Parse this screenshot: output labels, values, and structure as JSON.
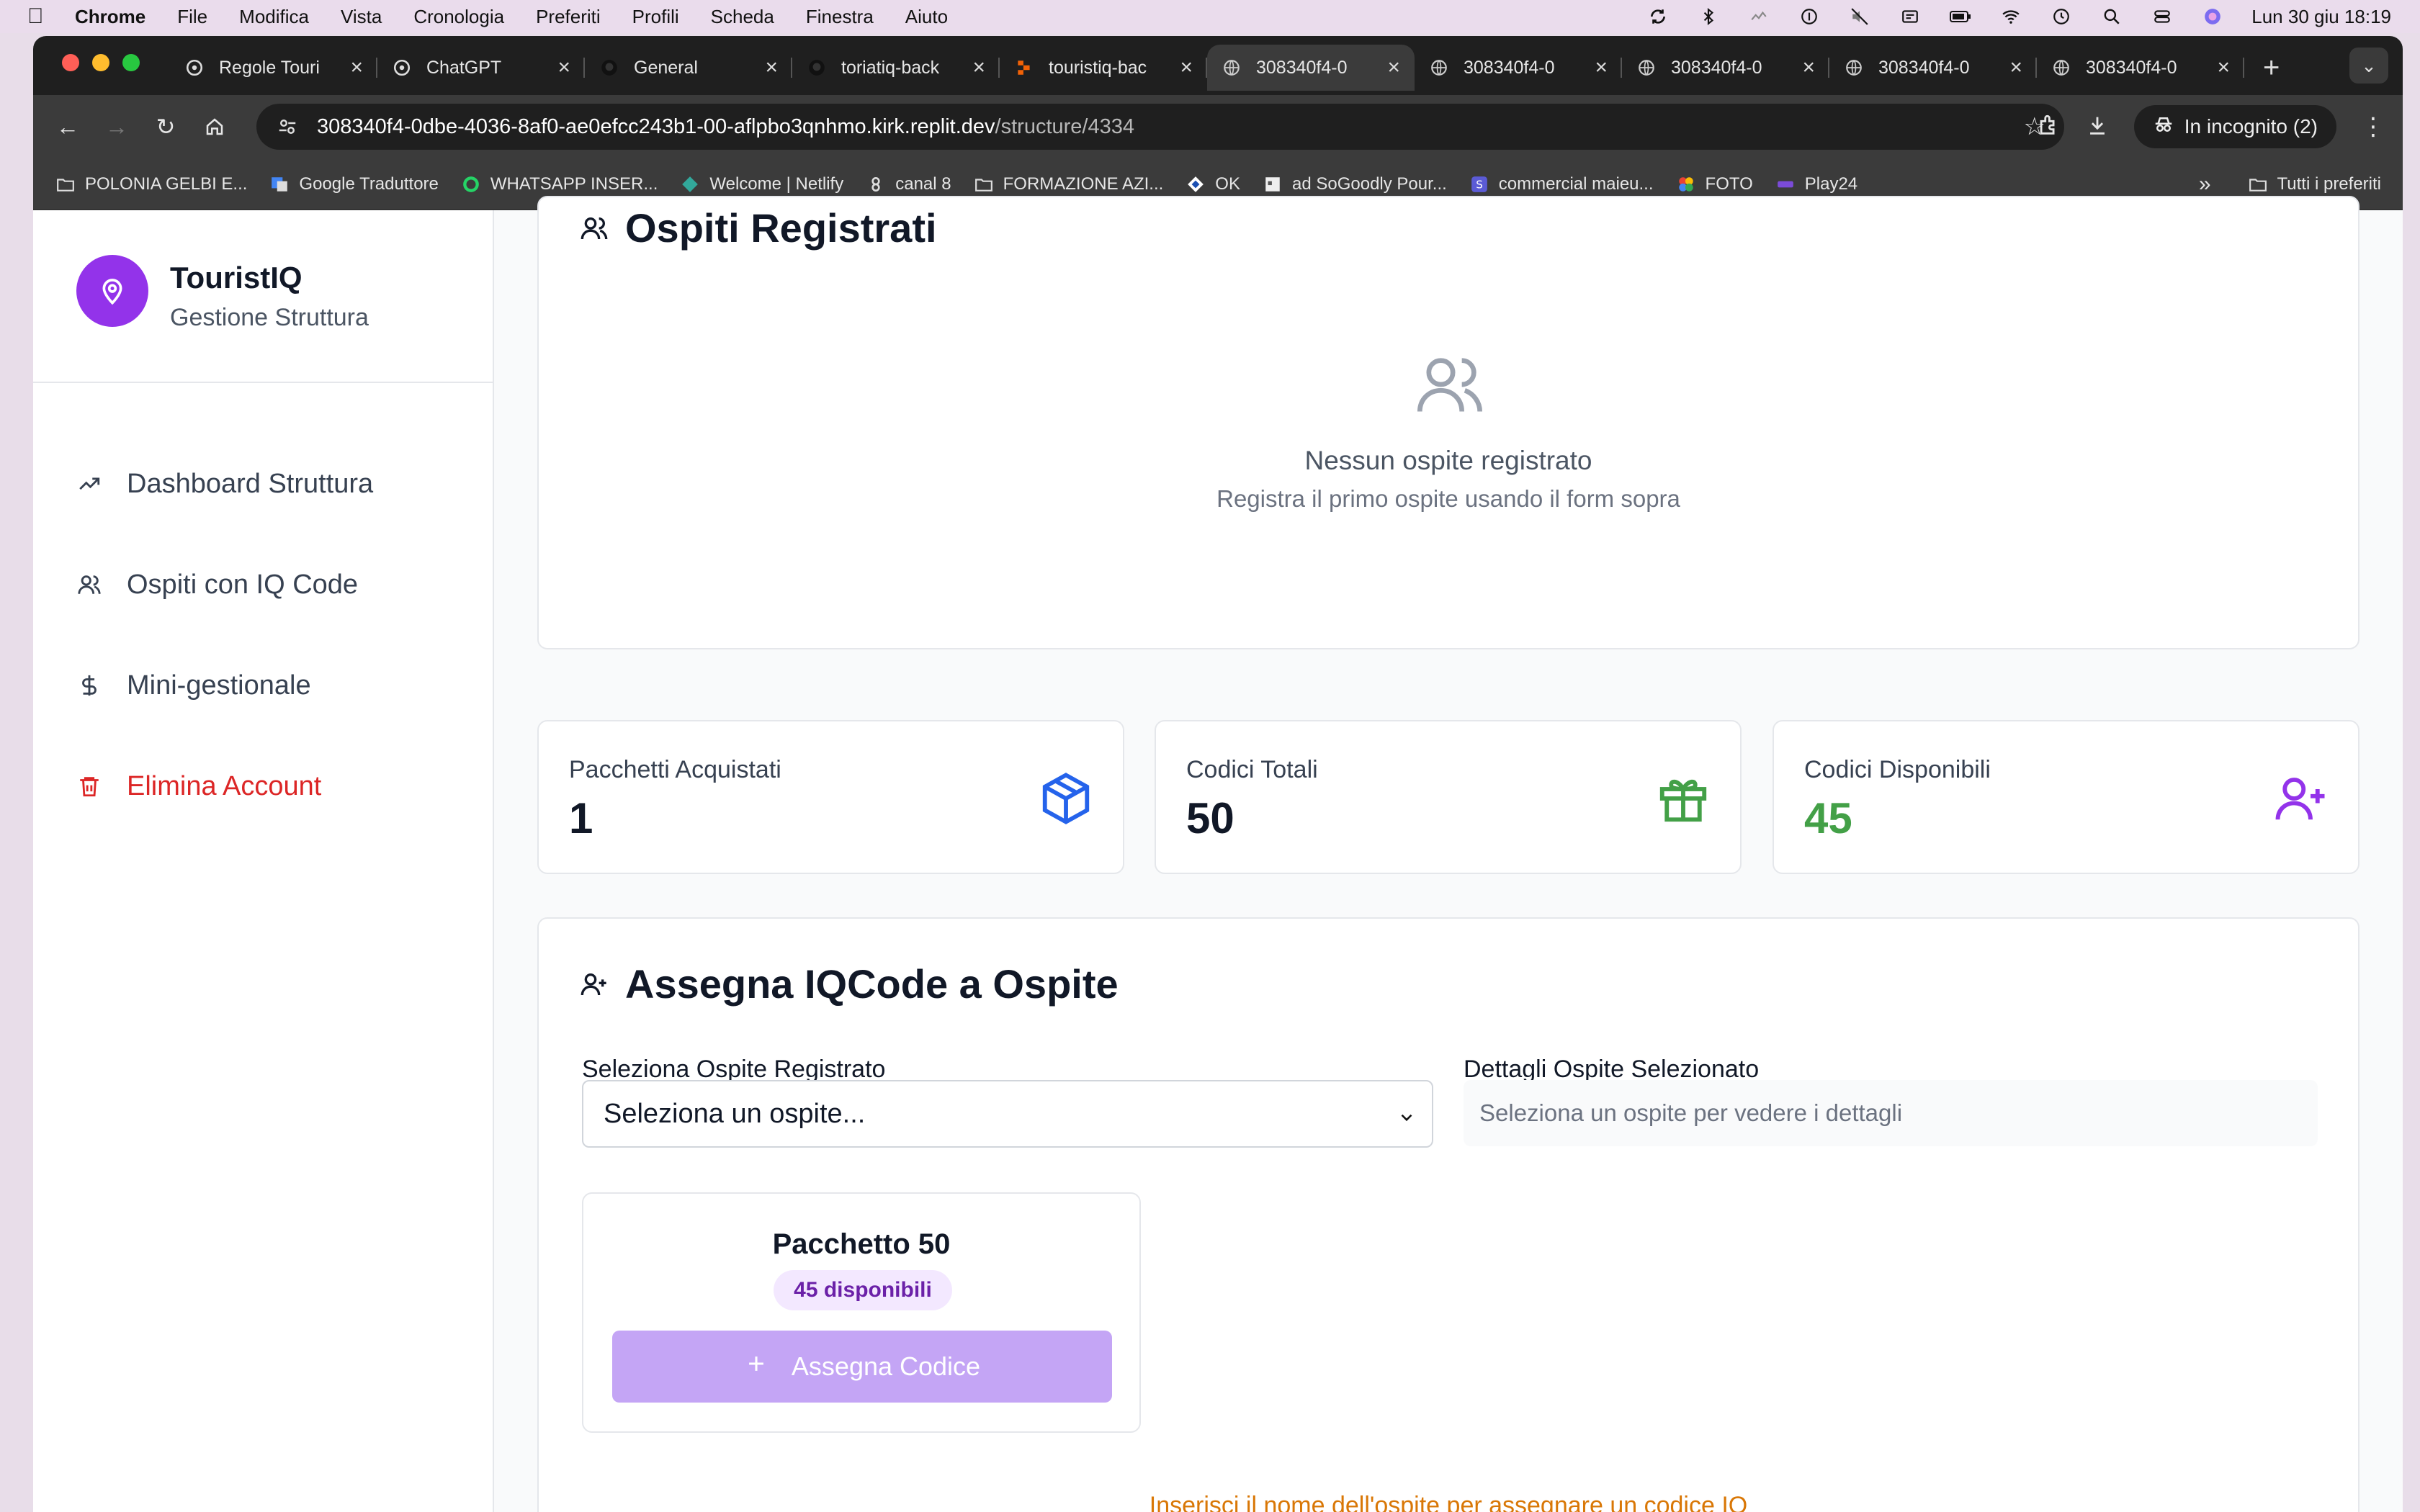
{
  "menubar": {
    "app": "Chrome",
    "items": [
      "File",
      "Modifica",
      "Vista",
      "Cronologia",
      "Preferiti",
      "Profili",
      "Scheda",
      "Finestra",
      "Aiuto"
    ],
    "datetime": "Lun 30 giu  18:19"
  },
  "browser": {
    "tabs": [
      {
        "title": "Regole Touri",
        "icon": "openai-icon"
      },
      {
        "title": "ChatGPT",
        "icon": "openai-icon"
      },
      {
        "title": "General",
        "icon": "github-icon"
      },
      {
        "title": "toriatiq-back",
        "icon": "github-icon"
      },
      {
        "title": "touristiq-bac",
        "icon": "replit-icon"
      },
      {
        "title": "308340f4-0",
        "icon": "globe-icon",
        "active": true
      },
      {
        "title": "308340f4-0",
        "icon": "globe-icon"
      },
      {
        "title": "308340f4-0",
        "icon": "globe-icon"
      },
      {
        "title": "308340f4-0",
        "icon": "globe-icon"
      },
      {
        "title": "308340f4-0",
        "icon": "globe-icon"
      }
    ],
    "url_host": "308340f4-0dbe-4036-8af0-ae0efcc243b1-00-aflpbo3qnhmo.kirk.replit.dev",
    "url_path": "/structure/4334",
    "incognito_label": "In incognito (2)",
    "bookmarks": [
      {
        "label": "POLONIA GELBI E...",
        "icon": "folder-icon"
      },
      {
        "label": "Google Traduttore",
        "icon": "translate-icon"
      },
      {
        "label": "WHATSAPP INSER...",
        "icon": "whatsapp-icon"
      },
      {
        "label": "Welcome | Netlify",
        "icon": "netlify-icon"
      },
      {
        "label": "canal 8",
        "icon": "canal-icon"
      },
      {
        "label": "FORMAZIONE AZI...",
        "icon": "folder-icon"
      },
      {
        "label": "OK",
        "icon": "diamond-icon"
      },
      {
        "label": "ad SoGoodly Pour...",
        "icon": "ad-icon"
      },
      {
        "label": "commercial maieu...",
        "icon": "s-icon"
      },
      {
        "label": "FOTO",
        "icon": "photos-icon"
      },
      {
        "label": "Play24",
        "icon": "play-icon"
      }
    ],
    "all_bookmarks_label": "Tutti i preferiti"
  },
  "sidebar": {
    "brand_name": "TouristIQ",
    "brand_sub": "Gestione Struttura",
    "items": [
      {
        "label": "Dashboard Struttura",
        "icon": "trending-up-icon"
      },
      {
        "label": "Ospiti con IQ Code",
        "icon": "users-icon"
      },
      {
        "label": "Mini-gestionale",
        "icon": "dollar-icon"
      },
      {
        "label": "Elimina Account",
        "icon": "trash-icon",
        "danger": true
      }
    ]
  },
  "guests": {
    "title": "Ospiti Registrati",
    "empty_title": "Nessun ospite registrato",
    "empty_sub": "Registra il primo ospite usando il form sopra"
  },
  "stats": [
    {
      "label": "Pacchetti Acquistati",
      "value": "1",
      "icon": "package-icon",
      "color": "#2563eb"
    },
    {
      "label": "Codici Totali",
      "value": "50",
      "icon": "gift-icon",
      "color": "#43a047"
    },
    {
      "label": "Codici Disponibili",
      "value": "45",
      "icon": "user-plus-icon",
      "color": "#9333ea"
    }
  ],
  "assign": {
    "title": "Assegna IQCode a Ospite",
    "select_label": "Seleziona Ospite Registrato",
    "select_value": "Seleziona un ospite...",
    "details_label": "Dettagli Ospite Selezionato",
    "details_placeholder": "Seleziona un ospite per vedere i dettagli",
    "package_name": "Pacchetto 50",
    "package_badge": "45 disponibili",
    "assign_button": "Assegna Codice",
    "warning": "Inserisci il nome dell'ospite per assegnare un codice IQ"
  },
  "colors": {
    "accent": "#9333ea",
    "danger": "#dc2626",
    "warning": "#d97706",
    "button_disabled": "#c4a5f5"
  }
}
